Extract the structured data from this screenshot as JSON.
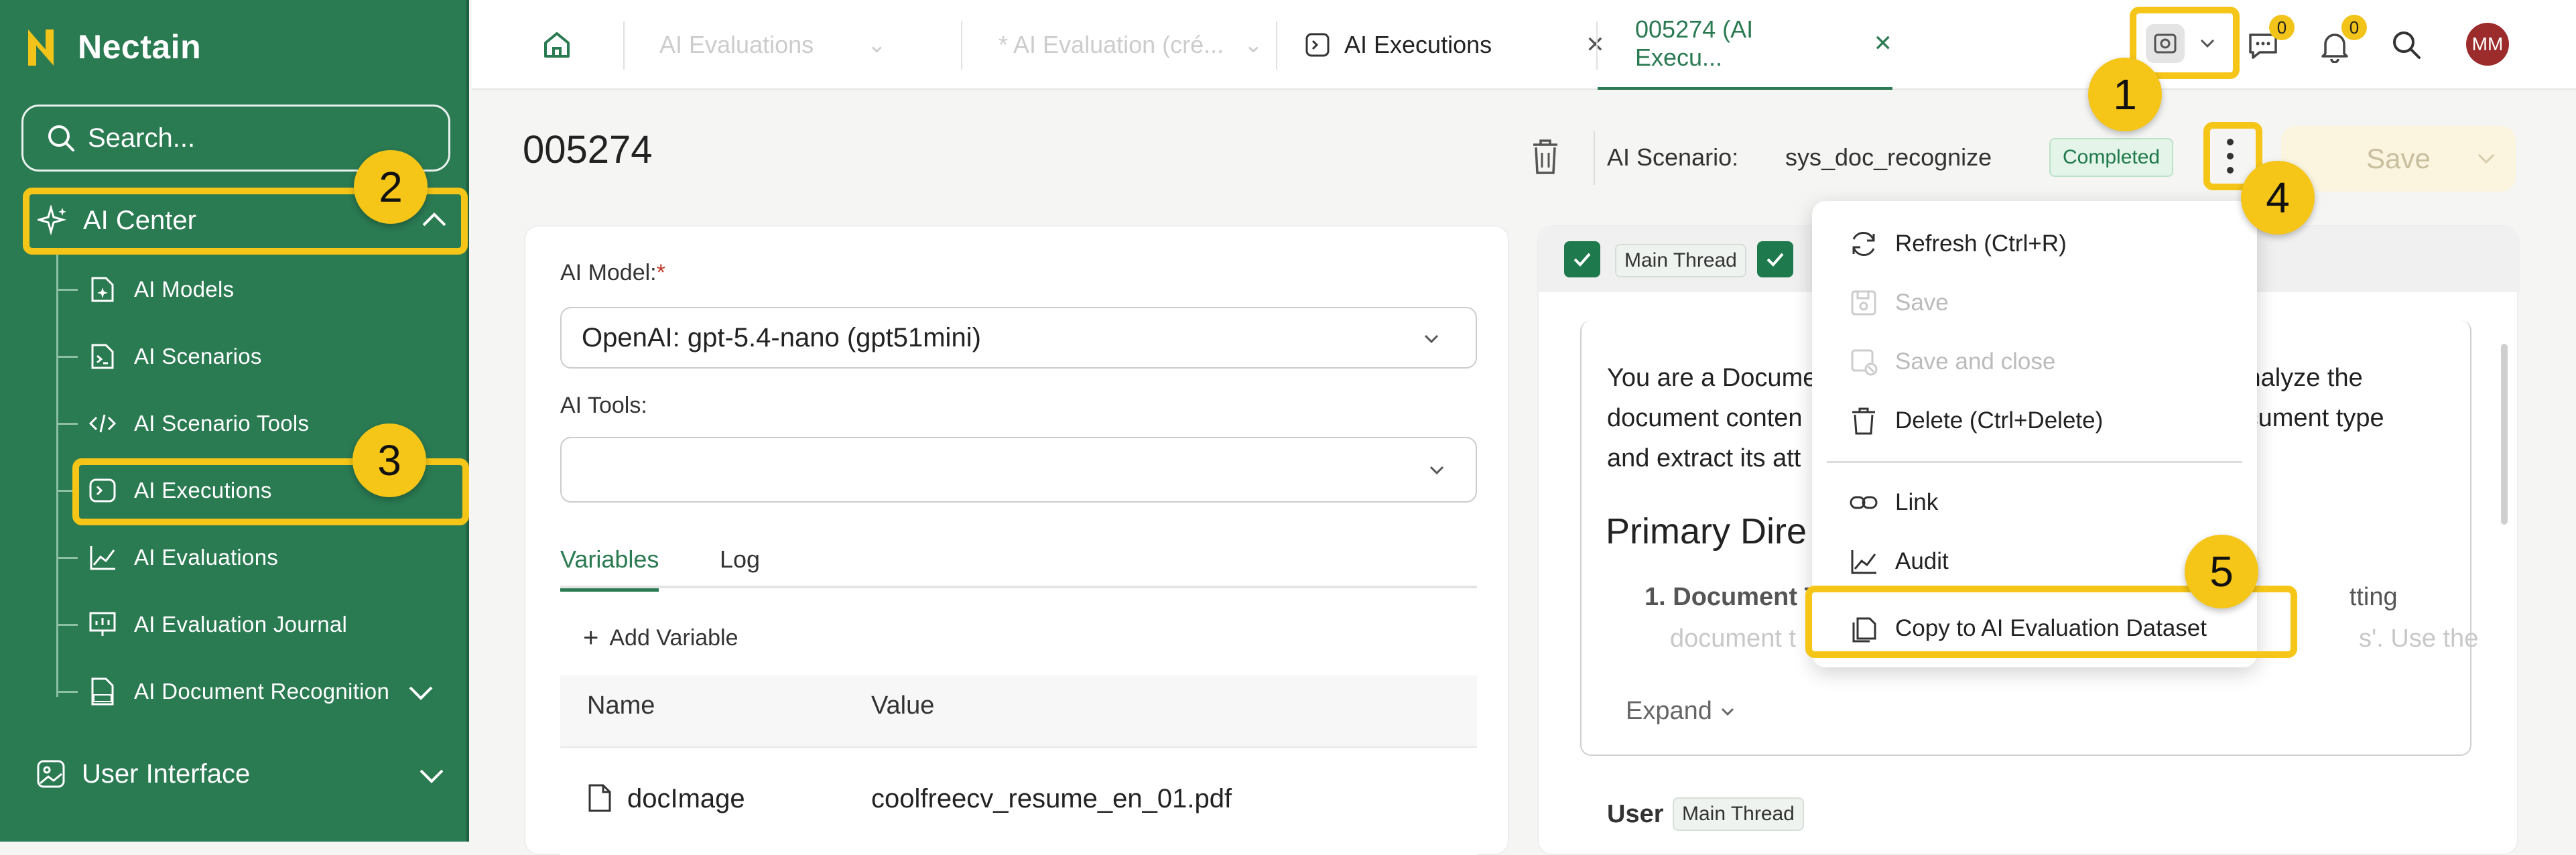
{
  "sidebar": {
    "brand": "Nectain",
    "search_placeholder": "Search...",
    "ai_center": "AI Center",
    "items": [
      "AI Models",
      "AI Scenarios",
      "AI Scenario Tools",
      "AI Executions",
      "AI Evaluations",
      "AI Evaluation Journal",
      "AI Document Recognition"
    ],
    "user_interface": "User Interface"
  },
  "topbar": {
    "tab1": "AI Evaluations",
    "tab2": "* AI Evaluation (cré...",
    "tab3": "AI Executions",
    "tab4": "005274 (AI Execu...",
    "notifications_count": "0",
    "messages_count": "0",
    "avatar": "MM"
  },
  "content": {
    "title": "005274",
    "scenario_label": "AI Scenario:",
    "scenario_value": "sys_doc_recognize",
    "status": "Completed",
    "save": "Save",
    "ai_model_label": "AI Model:",
    "ai_model_value": "OpenAI: gpt-5.4-nano (gpt51mini)",
    "ai_tools_label": "AI Tools:",
    "tab_variables": "Variables",
    "tab_log": "Log",
    "add_variable": "Add Variable",
    "col_name": "Name",
    "col_value": "Value",
    "var_name": "docImage",
    "var_value": "coolfreecv_resume_en_01.pdf"
  },
  "right_panel": {
    "main_thread": "Main Thread",
    "text_line1_a": "You are a Docume",
    "text_line1_b": "analyze the",
    "text_line2_a": "document conten",
    "text_line2_b": "ocument type",
    "text_line3": "and extract its att",
    "heading": "Primary Dire",
    "list_item_bold": "1. Document T",
    "list_item_tail": "tting",
    "faded_line_a": "document t",
    "faded_line_b": "s'. Use the",
    "expand": "Expand",
    "user_label": "User",
    "user_badge": "Main Thread"
  },
  "menu": {
    "refresh": "Refresh (Ctrl+R)",
    "save": "Save",
    "save_close": "Save and close",
    "delete": "Delete (Ctrl+Delete)",
    "link": "Link",
    "audit": "Audit",
    "copy": "Copy to AI Evaluation Dataset"
  },
  "annotations": [
    "1",
    "2",
    "3",
    "4",
    "5"
  ],
  "colors": {
    "brand_green": "#2a7a52",
    "highlight": "#f5c517"
  }
}
